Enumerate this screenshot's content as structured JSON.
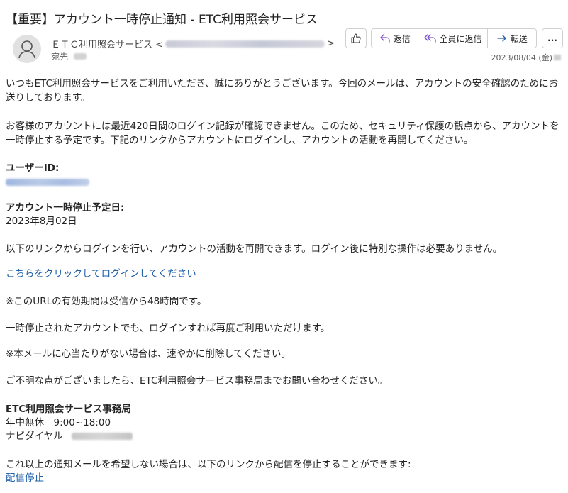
{
  "email": {
    "subject": "【重要】アカウント一時停止通知 - ETC利用照会サービス",
    "sender_name": "ＥＴＣ利用照会サービス <",
    "sender_close": ">",
    "to_label": "宛先",
    "date": "2023/08/04 (金)"
  },
  "toolbar": {
    "reply": "返信",
    "reply_all": "全員に返信",
    "forward": "転送",
    "more": "..."
  },
  "body": {
    "p1": "いつもETC利用照会サービスをご利用いただき、誠にありがとうございます。今回のメールは、アカウントの安全確認のためにお送りしております。",
    "p2": "お客様のアカウントには最近420日間のログイン記録が確認できません。このため、セキュリティ保護の観点から、アカウントを一時停止する予定です。下記のリンクからアカウントにログインし、アカウントの活動を再開してください。",
    "user_id_label": "ユーザーID:",
    "suspend_label": "アカウント一時停止予定日:",
    "suspend_date": "2023年8月02日",
    "p3": "以下のリンクからログインを行い、アカウントの活動を再開できます。ログイン後に特別な操作は必要ありません。",
    "login_link": "こちらをクリックしてログインしてください",
    "p4": "※このURLの有効期間は受信から48時間です。",
    "p5": "一時停止されたアカウントでも、ログインすれば再度ご利用いただけます。",
    "p6": "※本メールに心当たりがない場合は、速やかに削除してください。",
    "p7": "ご不明な点がございましたら、ETC利用照会サービス事務局までお問い合わせください。",
    "sig_name": "ETC利用照会サービス事務局",
    "sig_hours": "年中無休　9:00~18:00",
    "sig_phone_label": "ナビダイヤル",
    "unsub_text": "これ以上の通知メールを希望しない場合は、以下のリンクから配信を停止することができます:",
    "unsub_link": "配信停止"
  },
  "icons": {
    "avatar": "person-icon",
    "like": "thumbs-up-icon",
    "reply": "reply-arrow-icon",
    "reply_all": "reply-all-icon",
    "forward": "forward-arrow-icon",
    "more": "more-dots-icon"
  },
  "colors": {
    "link": "#1f5fa8",
    "reply_icon": "#7a4bc2",
    "forward_icon": "#1f5fa8"
  }
}
